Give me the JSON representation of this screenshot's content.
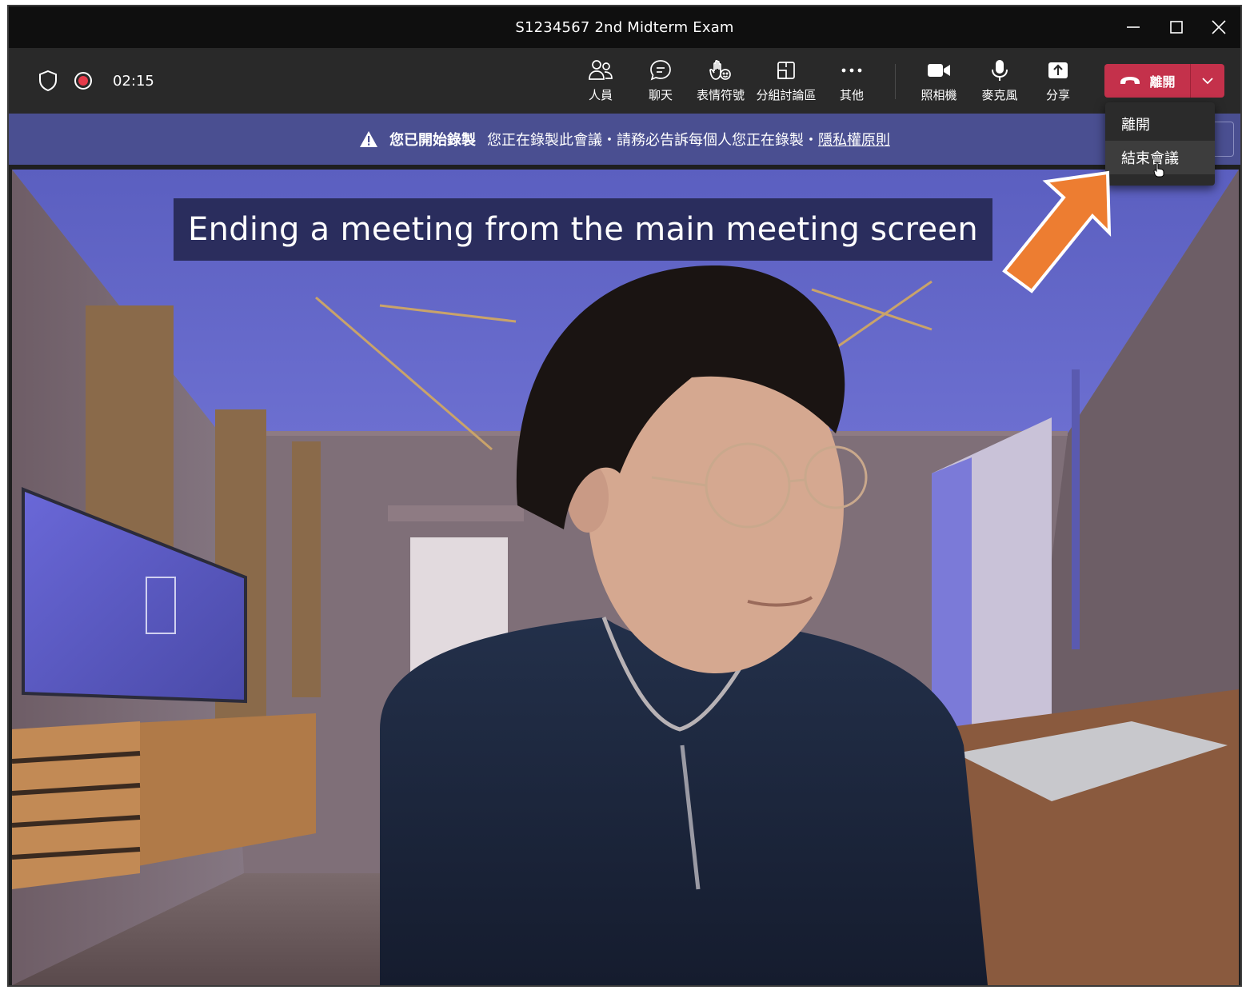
{
  "window": {
    "title": "S1234567 2nd Midterm Exam"
  },
  "toolbar": {
    "timer": "02:15",
    "buttons": {
      "people": "人員",
      "chat": "聊天",
      "reactions": "表情符號",
      "rooms": "分組討論區",
      "more": "其他",
      "camera": "照相機",
      "mic": "麥克風",
      "share": "分享"
    },
    "leave_label": "離開"
  },
  "banner": {
    "title": "您已開始錄製",
    "message": "您正在錄製此會議・請務必告訴每個人您正在錄製・",
    "link": "隱私權原則"
  },
  "menu": {
    "items": [
      "離開",
      "結束會議"
    ]
  },
  "caption": "Ending a meeting from the main meeting screen",
  "colors": {
    "leave_red": "#c4314b",
    "banner": "#4a4f91",
    "arrow": "#ed7d31",
    "recording_dot": "#e53a4a"
  },
  "icons": [
    "shield-icon",
    "recording-icon",
    "people-icon",
    "chat-icon",
    "reaction-icon",
    "breakout-rooms-icon",
    "more-icon",
    "camera-icon",
    "mic-icon",
    "share-icon",
    "hang-up-icon",
    "chevron-down-icon",
    "warning-icon",
    "minimize-icon",
    "maximize-icon",
    "close-icon"
  ]
}
